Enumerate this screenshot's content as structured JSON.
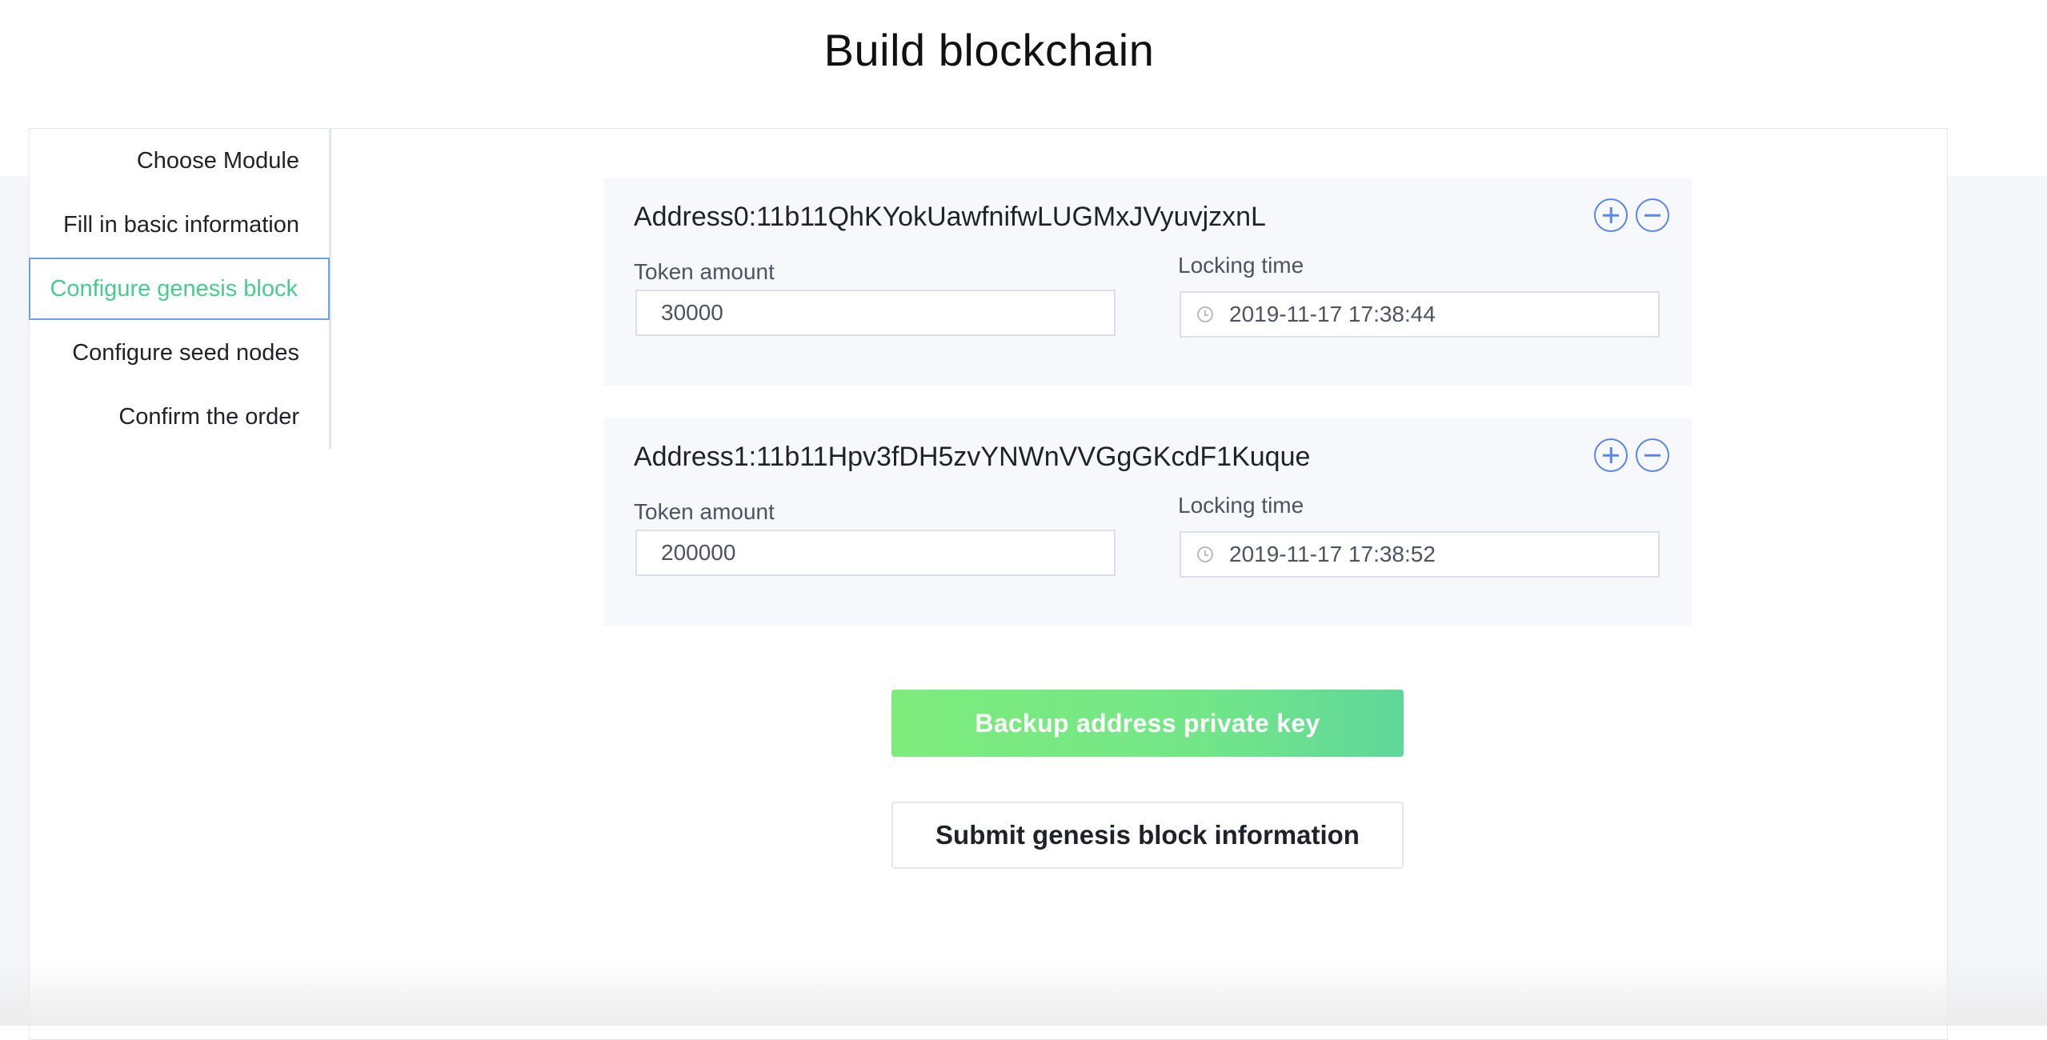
{
  "page": {
    "title": "Build blockchain"
  },
  "steps": [
    {
      "label": "Choose Module",
      "active": false
    },
    {
      "label": "Fill in basic information",
      "active": false
    },
    {
      "label": "Configure genesis block",
      "active": true
    },
    {
      "label": "Configure seed nodes",
      "active": false
    },
    {
      "label": "Confirm the order",
      "active": false
    }
  ],
  "addresses": [
    {
      "address": "Address0:11b11QhKYokUawfnifwLUGMxJVyuvjzxnL",
      "token_label": "Token amount",
      "token_value": "30000",
      "lock_label": "Locking time",
      "lock_value": "2019-11-17 17:38:44"
    },
    {
      "address": "Address1:11b11Hpv3fDH5zvYNWnVVGgGKcdF1Kuque",
      "token_label": "Token amount",
      "token_value": "200000",
      "lock_label": "Locking time",
      "lock_value": "2019-11-17 17:38:52"
    }
  ],
  "actions": {
    "backup_label": "Backup address private key",
    "submit_label": "Submit genesis block information"
  },
  "colors": {
    "accent_green": "#47cc8e",
    "accent_blue": "#5b88e6",
    "backup_gradient_start": "#7eec7c",
    "backup_gradient_end": "#5fd79a"
  },
  "icons": {
    "add": "plus-circle-icon",
    "remove": "minus-circle-icon",
    "time": "clock-icon"
  }
}
